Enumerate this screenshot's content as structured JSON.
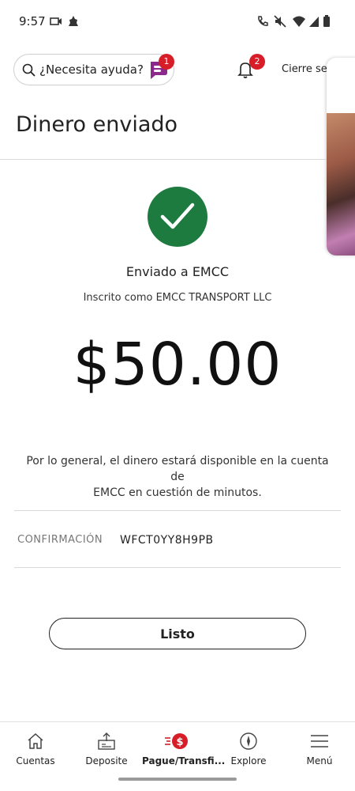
{
  "status_bar": {
    "time": "9:57"
  },
  "header": {
    "search_placeholder": "¿Necesita ayuda?",
    "chat_badge": "1",
    "notification_badge": "2",
    "signout_label": "Cierre ses"
  },
  "page": {
    "title": "Dinero enviado"
  },
  "confirmation": {
    "recipient_line": "Enviado a EMCC",
    "enrolled_line": "Inscrito como EMCC TRANSPORT LLC",
    "amount": "$50.00",
    "availability_line1": "Por lo general, el dinero estará disponible en la cuenta de",
    "availability_line2": "EMCC en cuestión de minutos.",
    "confirmation_label": "CONFIRMACIÓN",
    "confirmation_number": "WFCT0YY8H9PB",
    "done_label": "Listo"
  },
  "bottom_nav": {
    "items": [
      {
        "label": "Cuentas",
        "icon": "home-icon"
      },
      {
        "label": "Deposite",
        "icon": "deposit-icon"
      },
      {
        "label": "Pague/Transfi...",
        "icon": "pay-transfer-icon"
      },
      {
        "label": "Explore",
        "icon": "compass-icon"
      },
      {
        "label": "Menú",
        "icon": "hamburger-menu-icon"
      }
    ],
    "active_index": 2
  },
  "colors": {
    "accent_red": "#d71e28",
    "success_green": "#1d7b3f",
    "text_dark": "#222222"
  }
}
